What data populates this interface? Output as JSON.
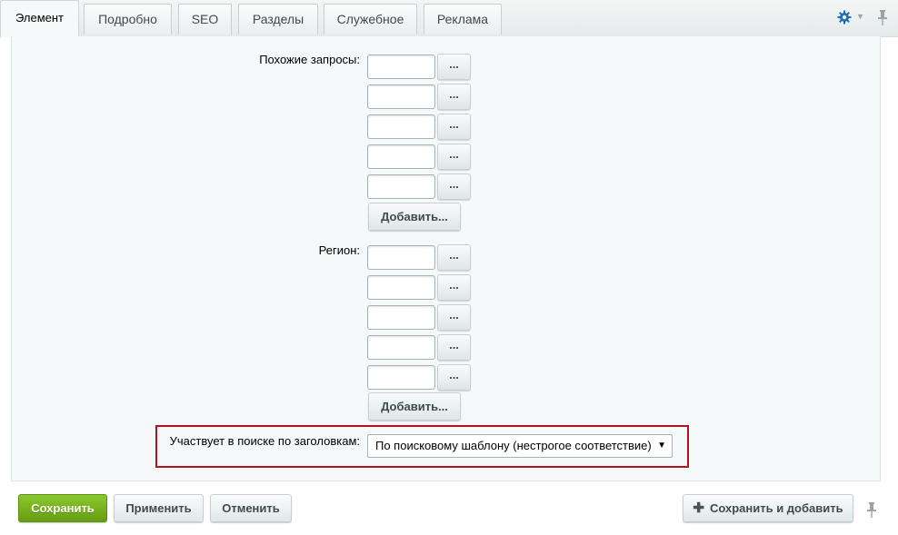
{
  "tabs": [
    {
      "label": "Элемент",
      "active": true
    },
    {
      "label": "Подробно",
      "active": false
    },
    {
      "label": "SEO",
      "active": false
    },
    {
      "label": "Разделы",
      "active": false
    },
    {
      "label": "Служебное",
      "active": false
    },
    {
      "label": "Реклама",
      "active": false
    }
  ],
  "toolbar_icons": [
    "gear-icon",
    "chevron-down-icon",
    "pin-icon"
  ],
  "similar_queries": {
    "label": "Похожие запросы:",
    "fields": [
      "",
      "",
      "",
      "",
      ""
    ],
    "browse_label": "...",
    "add_label": "Добавить..."
  },
  "region": {
    "label": "Регион:",
    "fields": [
      "",
      "",
      "",
      "",
      ""
    ],
    "browse_label": "...",
    "add_label": "Добавить..."
  },
  "title_search": {
    "label": "Участвует в поиске по заголовкам:",
    "selected": "По поисковому шаблону (нестрогое соответствие)"
  },
  "footer": {
    "save_label": "Сохранить",
    "apply_label": "Применить",
    "cancel_label": "Отменить",
    "save_add_label": "Сохранить и добавить"
  },
  "colors": {
    "accent_green": "#7ab51f",
    "highlight_border": "#b0161b",
    "gear_blue": "#1e6fb8"
  }
}
